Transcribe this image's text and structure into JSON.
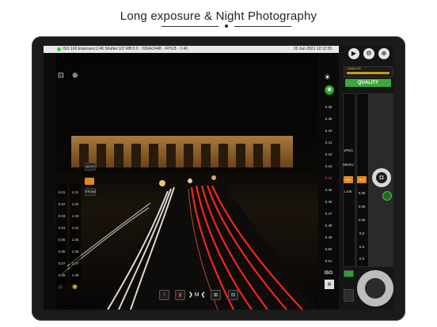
{
  "headline": "Long exposure & Night Photography",
  "status": {
    "info": "ISO 100 Exposure:2.46 Shutter:1/2 WB:0.0 · 3264x2448 · FPS:B · 1:40",
    "datetime": "20 Jun 2021 12:12:55 ."
  },
  "topbar": {
    "play_icon": "▶",
    "settings_icon": "⚙",
    "more_icon": "⊕"
  },
  "analog": {
    "label": "• ANALOG"
  },
  "quality": {
    "label": "QUALITY"
  },
  "right_panel": {
    "side_labels": [
      "JPEG",
      "MENU",
      "ISO",
      "LIVE"
    ],
    "buttons": [
      "0.3",
      "5.9"
    ],
    "values": [
      "0.05",
      "0.05",
      "0.05",
      "0.5",
      "0.5",
      "0.5",
      "0.5",
      "0.05"
    ]
  },
  "right_strip": {
    "values": [
      "0.36",
      "0.38",
      "0.40",
      "0.41",
      "0.42",
      "0.43",
      "0.44",
      "0.45",
      "0.46",
      "0.47",
      "0.48",
      "0.49",
      "0.50",
      "0.51"
    ],
    "iso_label": "ISO",
    "brightness_icon": "☀"
  },
  "left_columns": {
    "col1": [
      "0.01",
      "0.02",
      "0.03",
      "0.04",
      "0.05",
      "0.06",
      "0.07",
      "0.08"
    ],
    "col2": [
      "1.01",
      "1.02",
      "1.03",
      "1.04",
      "1.05",
      "1.06",
      "1.07",
      "1.08"
    ],
    "mode_labels": [
      "AUTO",
      "FRONT"
    ]
  },
  "bottom_bar": {
    "mode_text": "❯ M ❮"
  },
  "colors": {
    "accent_orange": "#e08820",
    "quality_green": "#3aa83a",
    "analog_gold": "#c99a1e",
    "light_trail_red": "#ff2a1a"
  }
}
